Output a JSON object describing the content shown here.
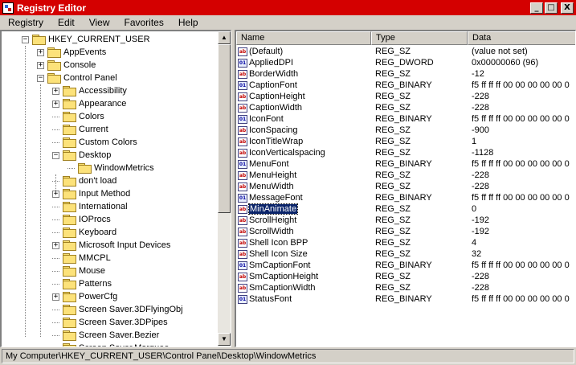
{
  "window": {
    "title": "Registry Editor",
    "minimize": "_",
    "maximize": "□",
    "close": "X"
  },
  "menu": [
    "Registry",
    "Edit",
    "View",
    "Favorites",
    "Help"
  ],
  "tree": {
    "items": [
      {
        "label": "HKEY_CURRENT_USER",
        "expander": "−",
        "level": 0
      },
      {
        "label": "AppEvents",
        "expander": "+",
        "level": 1
      },
      {
        "label": "Console",
        "expander": "+",
        "level": 1
      },
      {
        "label": "Control Panel",
        "expander": "−",
        "level": 1
      },
      {
        "label": "Accessibility",
        "expander": "+",
        "level": 2
      },
      {
        "label": "Appearance",
        "expander": "+",
        "level": 2
      },
      {
        "label": "Colors",
        "expander": "",
        "level": 2
      },
      {
        "label": "Current",
        "expander": "",
        "level": 2
      },
      {
        "label": "Custom Colors",
        "expander": "",
        "level": 2
      },
      {
        "label": "Desktop",
        "expander": "−",
        "level": 2
      },
      {
        "label": "WindowMetrics",
        "expander": "",
        "level": 3
      },
      {
        "label": "don't load",
        "expander": "",
        "level": 2
      },
      {
        "label": "Input Method",
        "expander": "+",
        "level": 2
      },
      {
        "label": "International",
        "expander": "",
        "level": 2
      },
      {
        "label": "IOProcs",
        "expander": "",
        "level": 2
      },
      {
        "label": "Keyboard",
        "expander": "",
        "level": 2
      },
      {
        "label": "Microsoft Input Devices",
        "expander": "+",
        "level": 2
      },
      {
        "label": "MMCPL",
        "expander": "",
        "level": 2
      },
      {
        "label": "Mouse",
        "expander": "",
        "level": 2
      },
      {
        "label": "Patterns",
        "expander": "",
        "level": 2
      },
      {
        "label": "PowerCfg",
        "expander": "+",
        "level": 2
      },
      {
        "label": "Screen Saver.3DFlyingObj",
        "expander": "",
        "level": 2
      },
      {
        "label": "Screen Saver.3DPipes",
        "expander": "",
        "level": 2
      },
      {
        "label": "Screen Saver.Bezier",
        "expander": "",
        "level": 2
      },
      {
        "label": "Screen Saver.Marquee",
        "expander": "",
        "level": 2
      }
    ]
  },
  "columns": {
    "name": "Name",
    "type": "Type",
    "data": "Data"
  },
  "values": [
    {
      "name": "(Default)",
      "type": "REG_SZ",
      "data": "(value not set)",
      "icon": "ab"
    },
    {
      "name": "AppliedDPI",
      "type": "REG_DWORD",
      "data": "0x00000060 (96)",
      "icon": "bin"
    },
    {
      "name": "BorderWidth",
      "type": "REG_SZ",
      "data": "-12",
      "icon": "ab"
    },
    {
      "name": "CaptionFont",
      "type": "REG_BINARY",
      "data": "f5 ff ff ff 00 00 00 00 00 0",
      "icon": "bin"
    },
    {
      "name": "CaptionHeight",
      "type": "REG_SZ",
      "data": "-228",
      "icon": "ab"
    },
    {
      "name": "CaptionWidth",
      "type": "REG_SZ",
      "data": "-228",
      "icon": "ab"
    },
    {
      "name": "IconFont",
      "type": "REG_BINARY",
      "data": "f5 ff ff ff 00 00 00 00 00 0",
      "icon": "bin"
    },
    {
      "name": "IconSpacing",
      "type": "REG_SZ",
      "data": "-900",
      "icon": "ab"
    },
    {
      "name": "IconTitleWrap",
      "type": "REG_SZ",
      "data": "1",
      "icon": "ab"
    },
    {
      "name": "IconVerticalspacing",
      "type": "REG_SZ",
      "data": "-1128",
      "icon": "ab"
    },
    {
      "name": "MenuFont",
      "type": "REG_BINARY",
      "data": "f5 ff ff ff 00 00 00 00 00 0",
      "icon": "bin"
    },
    {
      "name": "MenuHeight",
      "type": "REG_SZ",
      "data": "-228",
      "icon": "ab"
    },
    {
      "name": "MenuWidth",
      "type": "REG_SZ",
      "data": "-228",
      "icon": "ab"
    },
    {
      "name": "MessageFont",
      "type": "REG_BINARY",
      "data": "f5 ff ff ff 00 00 00 00 00 0",
      "icon": "bin"
    },
    {
      "name": "MinAnimate",
      "type": "REG_SZ",
      "data": "0",
      "icon": "ab",
      "selected": true
    },
    {
      "name": "ScrollHeight",
      "type": "REG_SZ",
      "data": "-192",
      "icon": "ab"
    },
    {
      "name": "ScrollWidth",
      "type": "REG_SZ",
      "data": "-192",
      "icon": "ab"
    },
    {
      "name": "Shell Icon BPP",
      "type": "REG_SZ",
      "data": "4",
      "icon": "ab"
    },
    {
      "name": "Shell Icon Size",
      "type": "REG_SZ",
      "data": "32",
      "icon": "ab"
    },
    {
      "name": "SmCaptionFont",
      "type": "REG_BINARY",
      "data": "f5 ff ff ff 00 00 00 00 00 0",
      "icon": "bin"
    },
    {
      "name": "SmCaptionHeight",
      "type": "REG_SZ",
      "data": "-228",
      "icon": "ab"
    },
    {
      "name": "SmCaptionWidth",
      "type": "REG_SZ",
      "data": "-228",
      "icon": "ab"
    },
    {
      "name": "StatusFont",
      "type": "REG_BINARY",
      "data": "f5 ff ff ff 00 00 00 00 00 0",
      "icon": "bin"
    }
  ],
  "statusbar": {
    "path": "My Computer\\HKEY_CURRENT_USER\\Control Panel\\Desktop\\WindowMetrics"
  },
  "colors": {
    "titlebar": "#d40000",
    "selection": "#0a246a",
    "face": "#d4d0c8"
  }
}
